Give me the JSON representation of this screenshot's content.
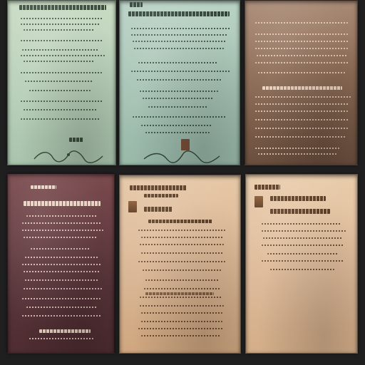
{
  "grid": {
    "sheets": [
      {
        "id": "sheet-1",
        "tone": "mint",
        "colors": {
          "bg1": "#c9dcc4",
          "bg2": "#a9c4ad",
          "ink": "#3d4e3f"
        }
      },
      {
        "id": "sheet-2",
        "tone": "mint",
        "colors": {
          "bg1": "#b9d2c4",
          "bg2": "#98b8a8",
          "ink": "#34463a"
        }
      },
      {
        "id": "sheet-3",
        "tone": "sepia-dark",
        "colors": {
          "bg1": "#a98a74",
          "bg2": "#6b4f3e",
          "ink": "#e6d2bf"
        }
      },
      {
        "id": "sheet-4",
        "tone": "maroon",
        "colors": {
          "bg1": "#7a4a4e",
          "bg2": "#4e2c31",
          "ink": "#e9d4c5"
        }
      },
      {
        "id": "sheet-5",
        "tone": "parchment",
        "colors": {
          "bg1": "#e6c7a6",
          "bg2": "#cfa67f",
          "ink": "#5a3c24"
        }
      },
      {
        "id": "sheet-6",
        "tone": "parchment",
        "colors": {
          "bg1": "#e9ccab",
          "bg2": "#d4ae89",
          "ink": "#5a3b24"
        }
      }
    ]
  }
}
